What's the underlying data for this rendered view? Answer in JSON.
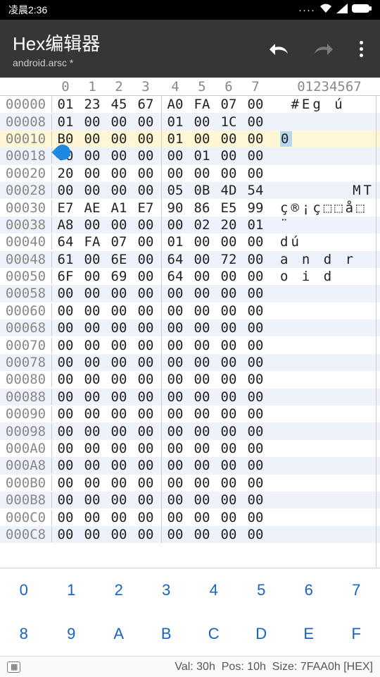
{
  "status_bar": {
    "time": "凌晨2:36",
    "icons": "···· ᯤ ⊿ ▭"
  },
  "toolbar": {
    "title": "Hex编辑器",
    "subtitle": "android.arsc *"
  },
  "hex_header": {
    "cols": [
      "0",
      "1",
      "2",
      "3",
      "4",
      "5",
      "6",
      "7"
    ],
    "ascii": "01234567"
  },
  "rows": [
    {
      "off": "00000",
      "b": [
        "01",
        "23",
        "45",
        "67",
        "A0",
        "FA",
        "07",
        "00"
      ],
      "asc": " #Eg ú",
      "hl": false
    },
    {
      "off": "00008",
      "b": [
        "01",
        "00",
        "00",
        "00",
        "01",
        "00",
        "1C",
        "00"
      ],
      "asc": "",
      "hl": false
    },
    {
      "off": "00010",
      "b": [
        "B0",
        "00",
        "00",
        "00",
        "01",
        "00",
        "00",
        "00"
      ],
      "asc": "0",
      "hl": true,
      "sel": true
    },
    {
      "off": "00018",
      "b": [
        "00",
        "00",
        "00",
        "00",
        "00",
        "01",
        "00",
        "00"
      ],
      "asc": "",
      "hl": false
    },
    {
      "off": "00020",
      "b": [
        "20",
        "00",
        "00",
        "00",
        "00",
        "00",
        "00",
        "00"
      ],
      "asc": "",
      "hl": false
    },
    {
      "off": "00028",
      "b": [
        "00",
        "00",
        "00",
        "00",
        "05",
        "0B",
        "4D",
        "54"
      ],
      "asc": "MT",
      "hl": false,
      "rt": true
    },
    {
      "off": "00030",
      "b": [
        "E7",
        "AE",
        "A1",
        "E7",
        "90",
        "86",
        "E5",
        "99"
      ],
      "asc": "ç®¡ç⬚⬚å⬚",
      "hl": false
    },
    {
      "off": "00038",
      "b": [
        "A8",
        "00",
        "00",
        "00",
        "00",
        "02",
        "20",
        "01"
      ],
      "asc": "¨",
      "hl": false
    },
    {
      "off": "00040",
      "b": [
        "64",
        "FA",
        "07",
        "00",
        "01",
        "00",
        "00",
        "00"
      ],
      "asc": "dú",
      "hl": false
    },
    {
      "off": "00048",
      "b": [
        "61",
        "00",
        "6E",
        "00",
        "64",
        "00",
        "72",
        "00"
      ],
      "asc": "a n d r",
      "hl": false
    },
    {
      "off": "00050",
      "b": [
        "6F",
        "00",
        "69",
        "00",
        "64",
        "00",
        "00",
        "00"
      ],
      "asc": "o i d",
      "hl": false
    },
    {
      "off": "00058",
      "b": [
        "00",
        "00",
        "00",
        "00",
        "00",
        "00",
        "00",
        "00"
      ],
      "asc": "",
      "hl": false
    },
    {
      "off": "00060",
      "b": [
        "00",
        "00",
        "00",
        "00",
        "00",
        "00",
        "00",
        "00"
      ],
      "asc": "",
      "hl": false
    },
    {
      "off": "00068",
      "b": [
        "00",
        "00",
        "00",
        "00",
        "00",
        "00",
        "00",
        "00"
      ],
      "asc": "",
      "hl": false
    },
    {
      "off": "00070",
      "b": [
        "00",
        "00",
        "00",
        "00",
        "00",
        "00",
        "00",
        "00"
      ],
      "asc": "",
      "hl": false
    },
    {
      "off": "00078",
      "b": [
        "00",
        "00",
        "00",
        "00",
        "00",
        "00",
        "00",
        "00"
      ],
      "asc": "",
      "hl": false
    },
    {
      "off": "00080",
      "b": [
        "00",
        "00",
        "00",
        "00",
        "00",
        "00",
        "00",
        "00"
      ],
      "asc": "",
      "hl": false
    },
    {
      "off": "00088",
      "b": [
        "00",
        "00",
        "00",
        "00",
        "00",
        "00",
        "00",
        "00"
      ],
      "asc": "",
      "hl": false
    },
    {
      "off": "00090",
      "b": [
        "00",
        "00",
        "00",
        "00",
        "00",
        "00",
        "00",
        "00"
      ],
      "asc": "",
      "hl": false
    },
    {
      "off": "00098",
      "b": [
        "00",
        "00",
        "00",
        "00",
        "00",
        "00",
        "00",
        "00"
      ],
      "asc": "",
      "hl": false
    },
    {
      "off": "000A0",
      "b": [
        "00",
        "00",
        "00",
        "00",
        "00",
        "00",
        "00",
        "00"
      ],
      "asc": "",
      "hl": false
    },
    {
      "off": "000A8",
      "b": [
        "00",
        "00",
        "00",
        "00",
        "00",
        "00",
        "00",
        "00"
      ],
      "asc": "",
      "hl": false
    },
    {
      "off": "000B0",
      "b": [
        "00",
        "00",
        "00",
        "00",
        "00",
        "00",
        "00",
        "00"
      ],
      "asc": "",
      "hl": false
    },
    {
      "off": "000B8",
      "b": [
        "00",
        "00",
        "00",
        "00",
        "00",
        "00",
        "00",
        "00"
      ],
      "asc": "",
      "hl": false
    },
    {
      "off": "000C0",
      "b": [
        "00",
        "00",
        "00",
        "00",
        "00",
        "00",
        "00",
        "00"
      ],
      "asc": "",
      "hl": false
    },
    {
      "off": "000C8",
      "b": [
        "00",
        "00",
        "00",
        "00",
        "00",
        "00",
        "00",
        "00"
      ],
      "asc": "",
      "hl": false
    }
  ],
  "keypad": {
    "row1": [
      "0",
      "1",
      "2",
      "3",
      "4",
      "5",
      "6",
      "7"
    ],
    "row2": [
      "8",
      "9",
      "A",
      "B",
      "C",
      "D",
      "E",
      "F"
    ]
  },
  "footer": {
    "val": "Val: 30h",
    "pos": "Pos: 10h",
    "size": "Size: 7FAA0h",
    "mode": "[HEX]"
  }
}
